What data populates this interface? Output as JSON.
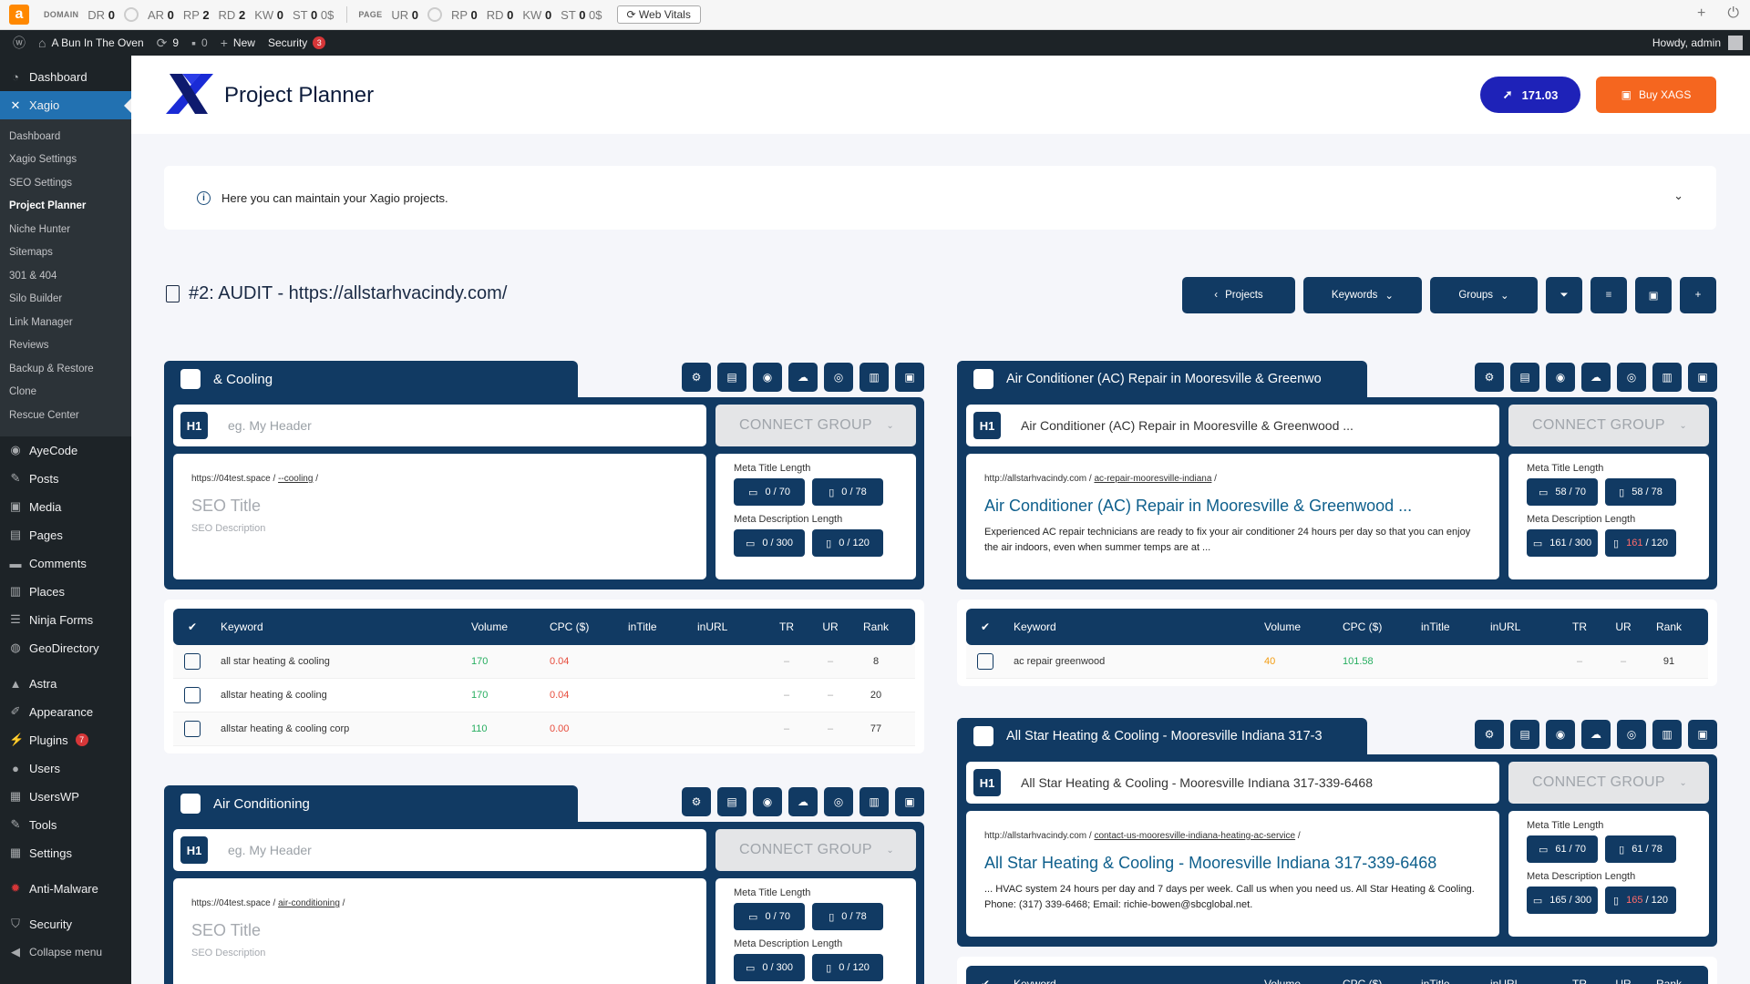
{
  "ahrefs": {
    "logo": "a",
    "domain_label": "DOMAIN",
    "domain_metrics": [
      {
        "k": "DR",
        "v": "0"
      },
      {
        "k": "AR",
        "v": "0"
      },
      {
        "k": "RP",
        "v": "2"
      },
      {
        "k": "RD",
        "v": "2"
      },
      {
        "k": "KW",
        "v": "0"
      },
      {
        "k": "ST",
        "v": "0"
      }
    ],
    "domain_st_unit": "0$",
    "page_label": "PAGE",
    "page_metrics": [
      {
        "k": "UR",
        "v": "0"
      },
      {
        "k": "RP",
        "v": "0"
      },
      {
        "k": "RD",
        "v": "0"
      },
      {
        "k": "KW",
        "v": "0"
      },
      {
        "k": "ST",
        "v": "0"
      }
    ],
    "page_st_unit": "0$",
    "web_vitals": "Web Vitals"
  },
  "adminbar": {
    "site_name": "A Bun In The Oven",
    "updates": "9",
    "comments": "0",
    "new": "New",
    "security": "Security",
    "security_count": "3",
    "howdy": "Howdy, admin"
  },
  "sidebar": {
    "items_top": [
      {
        "label": "Dashboard",
        "icon": "dashboard-icon",
        "glyph": "◔"
      },
      {
        "label": "Xagio",
        "icon": "xagio-icon",
        "glyph": "✕"
      }
    ],
    "submenu": [
      "Dashboard",
      "Xagio Settings",
      "SEO Settings",
      "Project Planner",
      "Niche Hunter",
      "Sitemaps",
      "301 & 404",
      "Silo Builder",
      "Link Manager",
      "Reviews",
      "Backup & Restore",
      "Clone",
      "Rescue Center"
    ],
    "items_mid": [
      {
        "label": "AyeCode",
        "glyph": "◉"
      },
      {
        "label": "Posts",
        "glyph": "✎"
      },
      {
        "label": "Media",
        "glyph": "▣"
      },
      {
        "label": "Pages",
        "glyph": "▤"
      },
      {
        "label": "Comments",
        "glyph": "▬"
      },
      {
        "label": "Places",
        "glyph": "▥"
      },
      {
        "label": "Ninja Forms",
        "glyph": "☰"
      },
      {
        "label": "GeoDirectory",
        "glyph": "◍"
      }
    ],
    "items_low": [
      {
        "label": "Astra",
        "glyph": "▲"
      },
      {
        "label": "Appearance",
        "glyph": "✐"
      },
      {
        "label": "Plugins",
        "glyph": "⚡",
        "badge": "7"
      },
      {
        "label": "Users",
        "glyph": "●"
      },
      {
        "label": "UsersWP",
        "glyph": "▦"
      },
      {
        "label": "Tools",
        "glyph": "✎"
      },
      {
        "label": "Settings",
        "glyph": "▦"
      }
    ],
    "anti_malware": "Anti-Malware",
    "security": "Security",
    "collapse": "Collapse menu"
  },
  "header": {
    "title": "Project Planner",
    "xags_value": "171.03",
    "buy_label": "Buy XAGS"
  },
  "info": {
    "text": "Here you can maintain your Xagio projects."
  },
  "project": {
    "title": "#2: AUDIT - https://allstarhvacindy.com/"
  },
  "toolbar": {
    "projects": "Projects",
    "keywords": "Keywords",
    "groups": "Groups"
  },
  "kw_headers": {
    "keyword": "Keyword",
    "volume": "Volume",
    "cpc": "CPC ($)",
    "intitle": "inTitle",
    "inurl": "inURL",
    "tr": "TR",
    "ur": "UR",
    "rank": "Rank"
  },
  "groups": [
    {
      "name": "& Cooling",
      "h1_placeholder": "eg. My Header",
      "h1": "",
      "connect": "CONNECT GROUP",
      "url_base": "https://04test.space",
      "url_slug": "--cooling",
      "seo_title": "SEO Title",
      "seo_desc": "SEO Description",
      "meta_title_label": "Meta Title Length",
      "meta_title_desktop": "0 / 70",
      "meta_title_mobile": "0 / 78",
      "meta_desc_label": "Meta Description Length",
      "meta_desc_desktop": "0 / 300",
      "meta_desc_mobile": "0 / 120",
      "keywords": [
        {
          "keyword": "all star heating & cooling",
          "volume": "170",
          "cpc": "0.04",
          "tr": "–",
          "ur": "–",
          "rank": "8"
        },
        {
          "keyword": "allstar heating & cooling",
          "volume": "170",
          "cpc": "0.04",
          "tr": "–",
          "ur": "–",
          "rank": "20"
        },
        {
          "keyword": "allstar heating & cooling corp",
          "volume": "110",
          "cpc": "0.00",
          "tr": "–",
          "ur": "–",
          "rank": "77"
        }
      ]
    },
    {
      "name": "Air Conditioning",
      "h1_placeholder": "eg. My Header",
      "h1": "",
      "connect": "CONNECT GROUP",
      "url_base": "https://04test.space",
      "url_slug": "air-conditioning",
      "seo_title": "SEO Title",
      "seo_desc": "SEO Description",
      "meta_title_label": "Meta Title Length",
      "meta_title_desktop": "0 / 70",
      "meta_title_mobile": "0 / 78",
      "meta_desc_label": "Meta Description Length",
      "meta_desc_desktop": "0 / 300",
      "meta_desc_mobile": "0 / 120"
    },
    {
      "name": "Air Conditioner (AC) Repair in Mooresville & Greenwo",
      "h1_placeholder": "eg. My Header",
      "h1": "Air Conditioner (AC) Repair in Mooresville & Greenwood ...",
      "connect": "CONNECT GROUP",
      "url_base": "http://allstarhvacindy.com",
      "url_slug": "ac-repair-mooresville-indiana",
      "seo_title": "Air Conditioner (AC) Repair in Mooresville & Greenwood ...",
      "seo_desc": "Experienced AC repair technicians are ready to fix your air conditioner 24 hours per day so that you can enjoy the air indoors, even when summer temps are at ...",
      "meta_title_label": "Meta Title Length",
      "meta_title_desktop": "58 / 70",
      "meta_title_mobile": "58 / 78",
      "meta_desc_label": "Meta Description Length",
      "meta_desc_desktop": "161 / 300",
      "meta_desc_mobile_num": "161",
      "meta_desc_mobile_den": " / 120",
      "keywords": [
        {
          "keyword": "ac repair greenwood",
          "volume": "40",
          "cpc": "101.58",
          "tr": "–",
          "ur": "–",
          "rank": "91"
        }
      ]
    },
    {
      "name": "All Star Heating & Cooling - Mooresville Indiana 317-3",
      "h1_placeholder": "eg. My Header",
      "h1": "All Star Heating & Cooling - Mooresville Indiana 317-339-6468",
      "connect": "CONNECT GROUP",
      "url_base": "http://allstarhvacindy.com",
      "url_slug": "contact-us-mooresville-indiana-heating-ac-service",
      "seo_title": "All Star Heating & Cooling - Mooresville Indiana 317-339-6468",
      "seo_desc": "... HVAC system 24 hours per day and 7 days per week. Call us when you need us. All Star Heating & Cooling. Phone: (317) 339-6468; Email: richie-bowen@sbcglobal.net.",
      "meta_title_label": "Meta Title Length",
      "meta_title_desktop": "61 / 70",
      "meta_title_mobile": "61 / 78",
      "meta_desc_label": "Meta Description Length",
      "meta_desc_desktop": "165 / 300",
      "meta_desc_mobile_num": "165",
      "meta_desc_mobile_den": " / 120"
    }
  ]
}
